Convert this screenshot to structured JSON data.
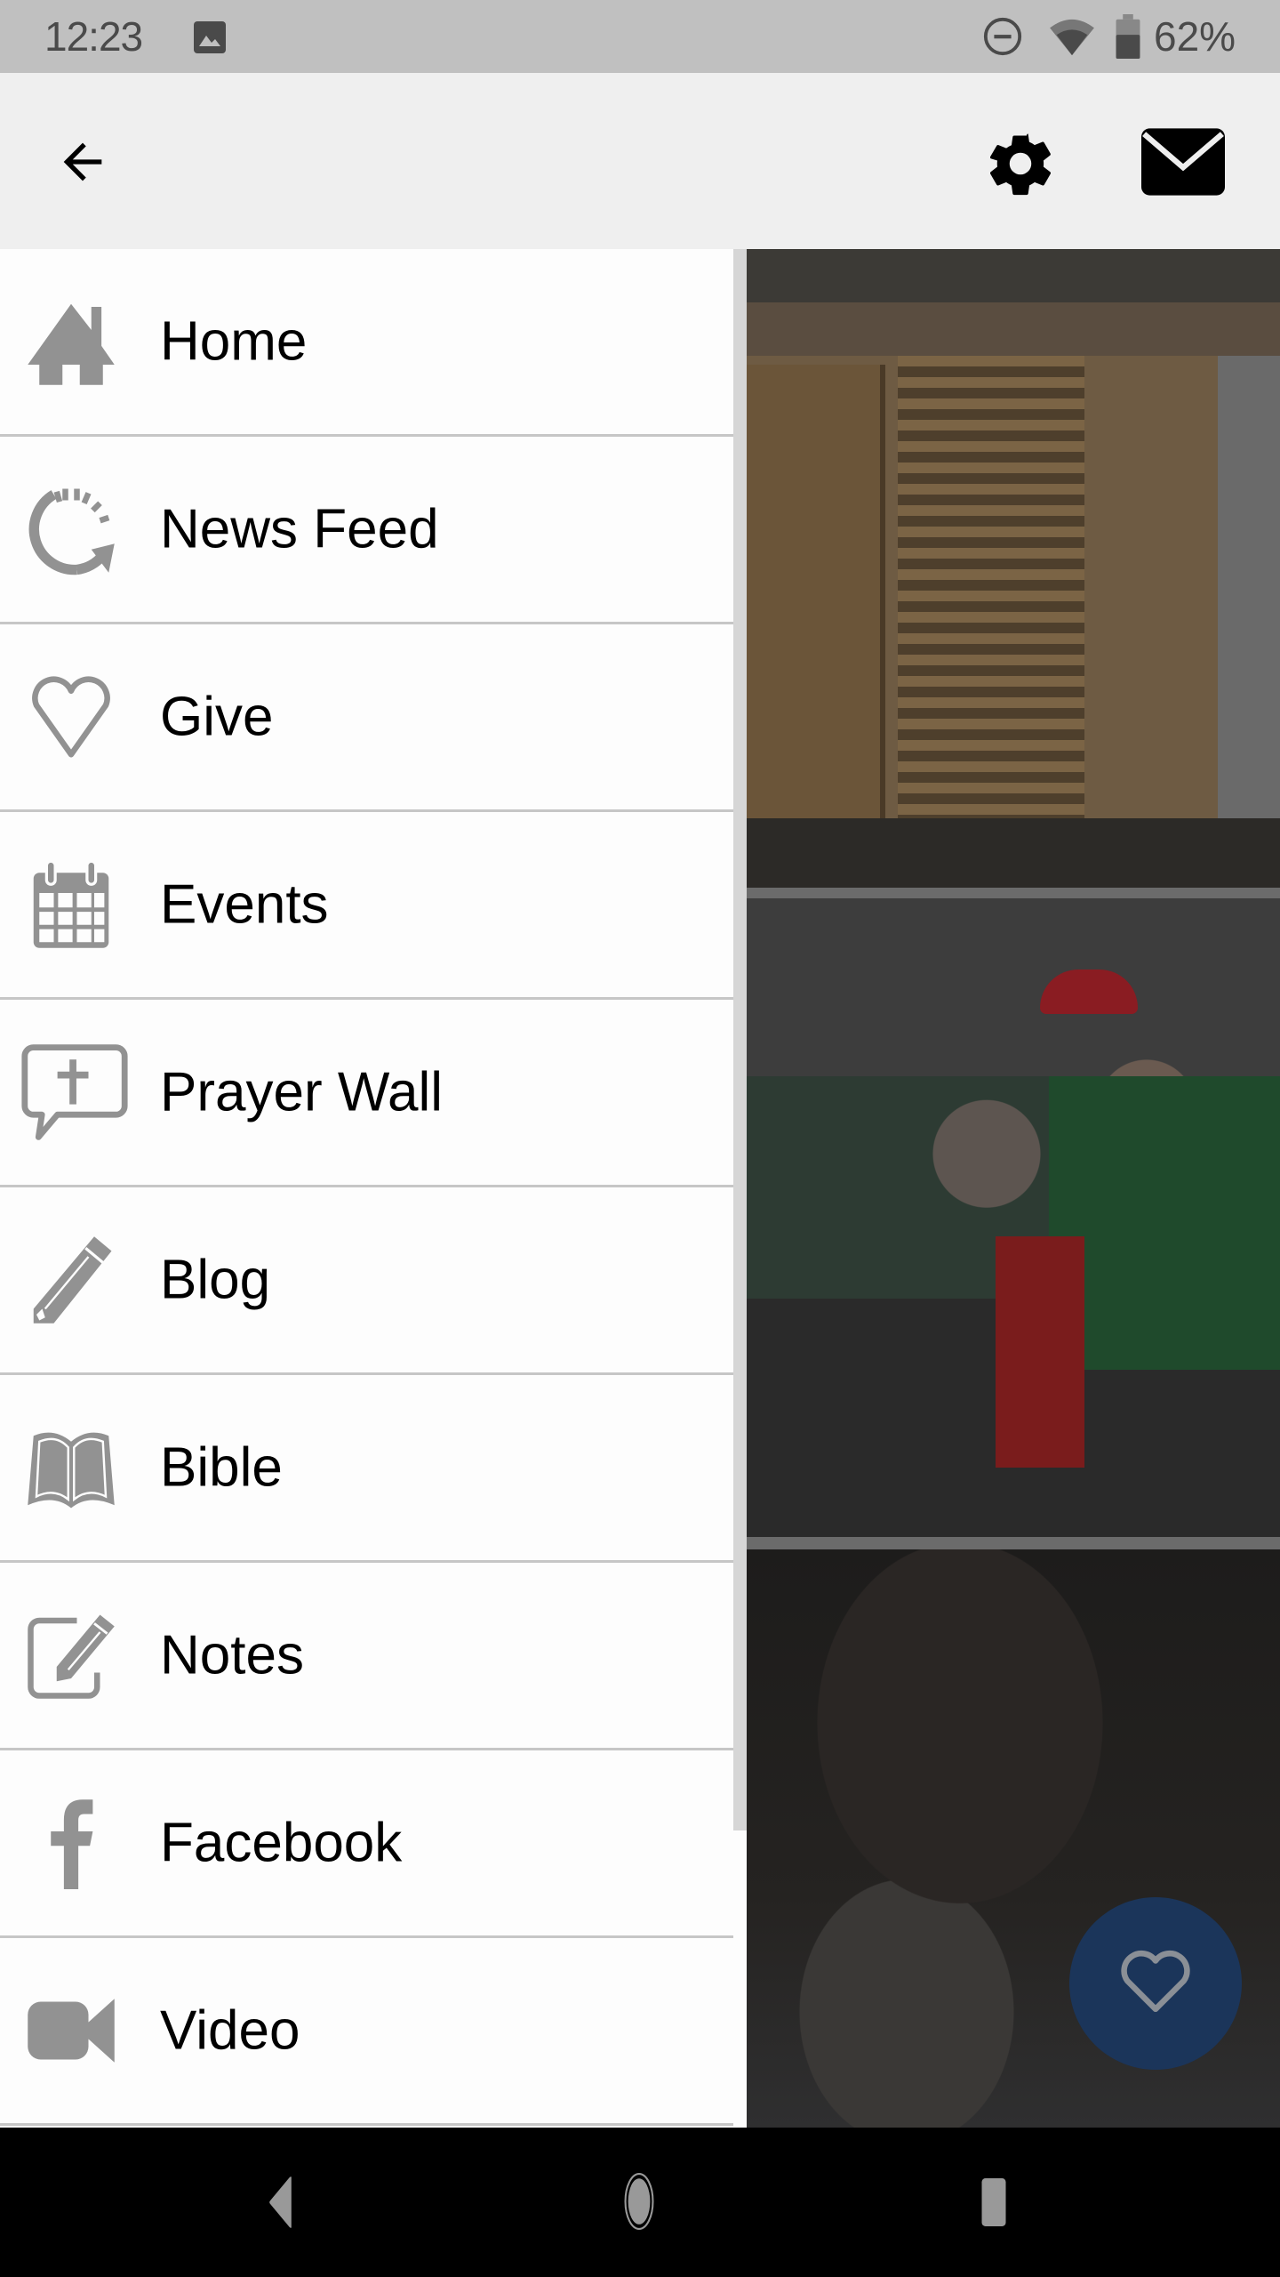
{
  "status_bar": {
    "time": "12:23",
    "notification_icons": [
      "image-icon"
    ],
    "system_icons": [
      "do-not-disturb-icon",
      "wifi-icon",
      "battery-icon"
    ],
    "battery_percent": "62%"
  },
  "app_bar": {
    "back_icon": "arrow-back-icon",
    "actions": [
      {
        "name": "settings",
        "icon": "gear-icon"
      },
      {
        "name": "messages",
        "icon": "envelope-icon"
      }
    ]
  },
  "drawer": {
    "items": [
      {
        "label": "Home",
        "icon": "home-icon"
      },
      {
        "label": "News Feed",
        "icon": "refresh-feed-icon"
      },
      {
        "label": "Give",
        "icon": "heart-outline-icon"
      },
      {
        "label": "Events",
        "icon": "calendar-icon"
      },
      {
        "label": "Prayer Wall",
        "icon": "speech-bubble-cross-icon"
      },
      {
        "label": "Blog",
        "icon": "pencil-icon"
      },
      {
        "label": "Bible",
        "icon": "open-book-icon"
      },
      {
        "label": "Notes",
        "icon": "edit-note-icon"
      },
      {
        "label": "Facebook",
        "icon": "facebook-icon"
      },
      {
        "label": "Video",
        "icon": "video-camera-icon"
      }
    ]
  },
  "content": {
    "photos": [
      "building-doorway-photo",
      "church-community-group-photo",
      "close-up-face-photo"
    ],
    "fab_icon": "heart-outline-icon"
  },
  "colors": {
    "status_bar_bg": "#c0c0c0",
    "app_bar_bg": "#efefef",
    "drawer_bg": "#fdfdfd",
    "divider": "#c6c6c6",
    "drawer_icon": "#929292",
    "fab_bg": "#1b355a",
    "nav_bar_bg": "#000000"
  },
  "nav_bar": {
    "buttons": [
      "back",
      "home",
      "recents"
    ]
  }
}
